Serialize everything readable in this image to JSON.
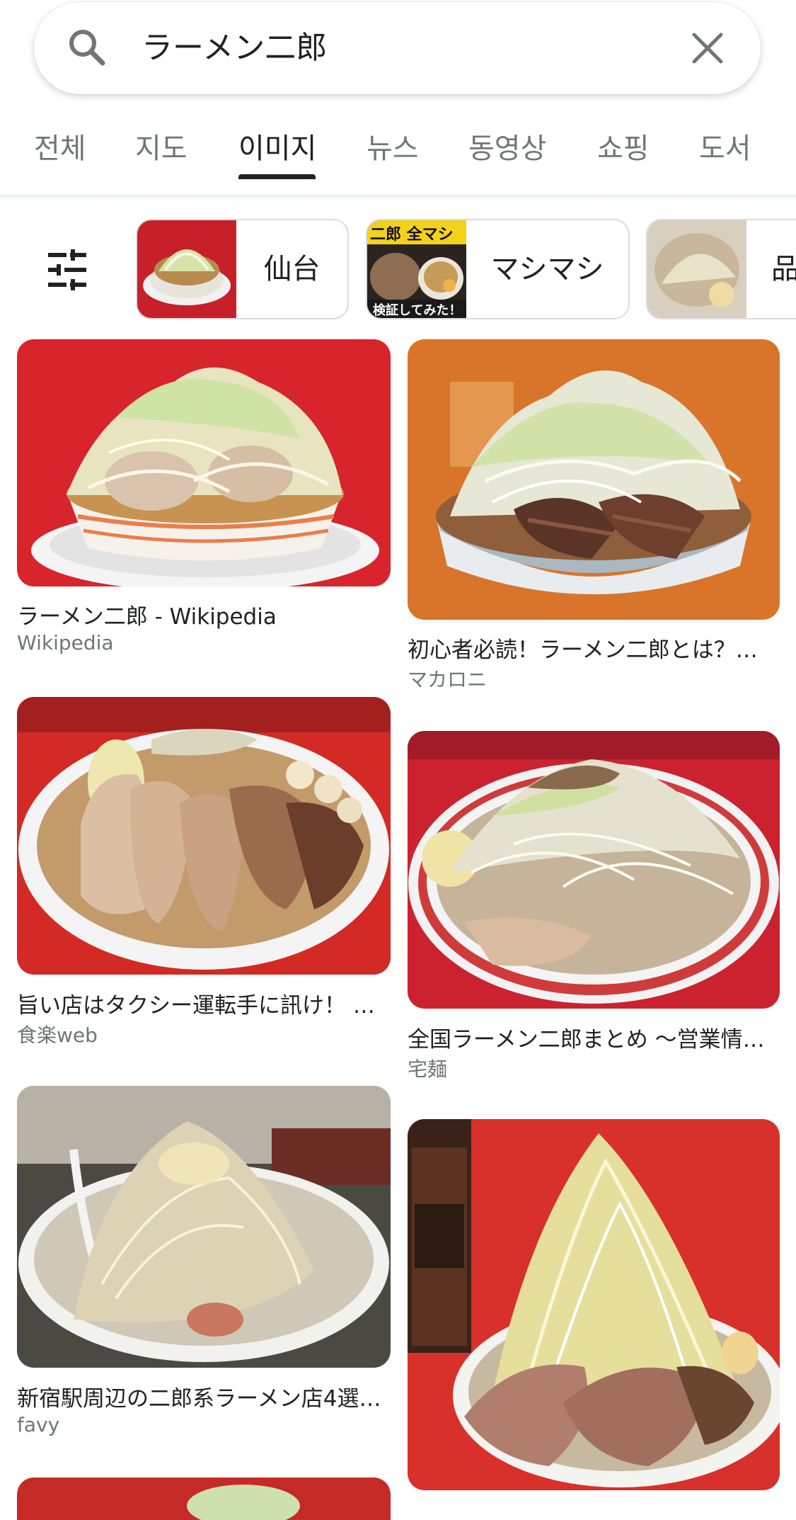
{
  "search": {
    "query": "ラーメン二郎"
  },
  "tabs": [
    {
      "label": "전체"
    },
    {
      "label": "지도"
    },
    {
      "label": "이미지",
      "active": true
    },
    {
      "label": "뉴스"
    },
    {
      "label": "동영상"
    },
    {
      "label": "쇼핑"
    },
    {
      "label": "도서"
    }
  ],
  "chips": [
    {
      "label": "仙台"
    },
    {
      "label": "マシマシ",
      "thumb_text_top": "二郎 全マシ",
      "thumb_text_bottom": "検証してみた！"
    },
    {
      "label": "品"
    }
  ],
  "results": [
    {
      "title": "ラーメン二郎 - Wikipedia",
      "source": "Wikipedia"
    },
    {
      "title": "初心者必読！ラーメン二郎とは？…",
      "source": "マカロニ"
    },
    {
      "title": "旨い店はタクシー運転手に訊け！ …",
      "source": "食楽web"
    },
    {
      "title": "全国ラーメン二郎まとめ ～営業情…",
      "source": "宅麺"
    },
    {
      "title": "新宿駅周辺の二郎系ラーメン店4選…",
      "source": "favy"
    }
  ],
  "colors": {
    "accent": "#202124",
    "muted": "#70757a",
    "chip_border": "#dadce0",
    "table_red": "#d8242b"
  },
  "icons": {
    "search": "search-icon",
    "clear": "close-icon",
    "filter": "tune-icon"
  }
}
